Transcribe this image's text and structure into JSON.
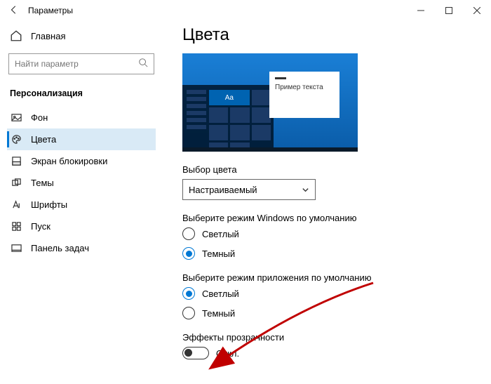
{
  "window": {
    "title": "Параметры"
  },
  "sidebar": {
    "home": "Главная",
    "search_placeholder": "Найти параметр",
    "section": "Персонализация",
    "items": [
      {
        "label": "Фон"
      },
      {
        "label": "Цвета"
      },
      {
        "label": "Экран блокировки"
      },
      {
        "label": "Темы"
      },
      {
        "label": "Шрифты"
      },
      {
        "label": "Пуск"
      },
      {
        "label": "Панель задач"
      }
    ]
  },
  "page": {
    "heading": "Цвета",
    "preview": {
      "tile_text": "Aa",
      "sample_text": "Пример текста"
    },
    "color_choice": {
      "label": "Выбор цвета",
      "value": "Настраиваемый"
    },
    "windows_mode": {
      "label": "Выберите режим Windows по умолчанию",
      "options": {
        "light": "Светлый",
        "dark": "Темный"
      },
      "selected": "dark"
    },
    "app_mode": {
      "label": "Выберите режим приложения по умолчанию",
      "options": {
        "light": "Светлый",
        "dark": "Темный"
      },
      "selected": "light"
    },
    "transparency": {
      "label": "Эффекты прозрачности",
      "state_text": "Откл.",
      "enabled": false
    }
  },
  "annotation": {
    "arrow_color": "#c00000"
  }
}
